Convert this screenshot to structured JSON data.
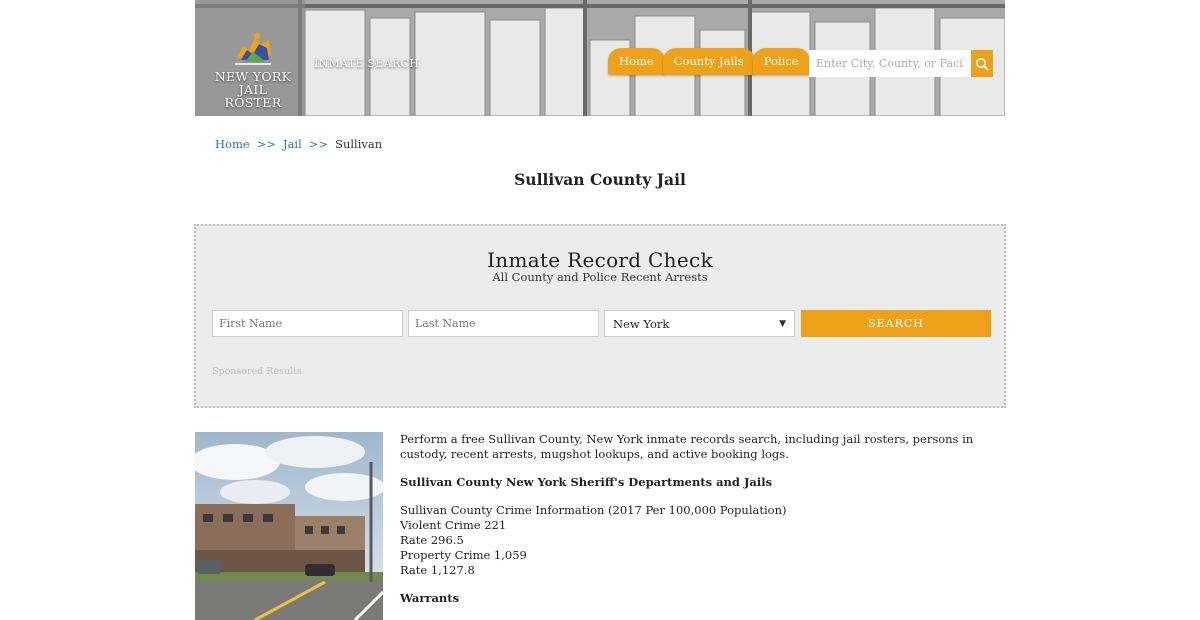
{
  "header": {
    "logo_line1": "NEW YORK",
    "logo_line2": "JAIL ROSTER",
    "inmate_search_label": "INMATE SEARCH",
    "nav": [
      {
        "label": "Home"
      },
      {
        "label": "County Jails"
      },
      {
        "label": "Police"
      }
    ],
    "search_placeholder": "Enter City, County, or Facility",
    "accent_color": "#f0a11a"
  },
  "breadcrumb": {
    "home": "Home",
    "jail": "Jail",
    "separator": ">>",
    "current": "Sullivan"
  },
  "page_title": "Sullivan County Jail",
  "record_check": {
    "title": "Inmate Record Check",
    "subtitle": "All County and Police Recent Arrests",
    "first_name_placeholder": "First Name",
    "last_name_placeholder": "Last Name",
    "state_selected": "New York",
    "search_button": "SEARCH",
    "sponsored": "Sponsored Results"
  },
  "content": {
    "intro": "Perform a free Sullivan County, New York inmate records search, including jail rosters, persons in custody, recent arrests, mugshot lookups, and active booking logs.",
    "departments_heading": "Sullivan County New York Sheriff's Departments and Jails",
    "crime_heading": "Sullivan County Crime Information (2017 Per 100,000 Population)",
    "violent_crime": "Violent Crime 221",
    "violent_rate": "Rate 296.5",
    "property_crime": "Property Crime 1,059",
    "property_rate": "Rate 1,127.8",
    "warrants_heading": "Warrants"
  }
}
